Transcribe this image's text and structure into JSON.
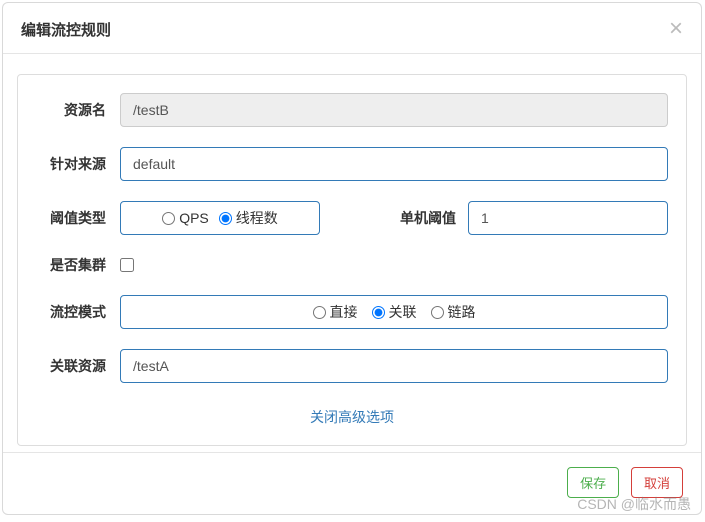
{
  "modal": {
    "title": "编辑流控规则",
    "close_label": "×"
  },
  "form": {
    "resource": {
      "label": "资源名",
      "value": "/testB"
    },
    "limitApp": {
      "label": "针对来源",
      "value": "default"
    },
    "thresholdType": {
      "label": "阈值类型",
      "options": {
        "qps": "QPS",
        "threads": "线程数"
      },
      "selected": "threads"
    },
    "threshold": {
      "label": "单机阈值",
      "value": "1"
    },
    "cluster": {
      "label": "是否集群",
      "checked": false
    },
    "mode": {
      "label": "流控模式",
      "options": {
        "direct": "直接",
        "relate": "关联",
        "chain": "链路"
      },
      "selected": "relate"
    },
    "refResource": {
      "label": "关联资源",
      "value": "/testA"
    },
    "advancedToggle": "关闭高级选项"
  },
  "footer": {
    "save": "保存",
    "cancel": "取消"
  },
  "watermark": "CSDN @临水而愚"
}
